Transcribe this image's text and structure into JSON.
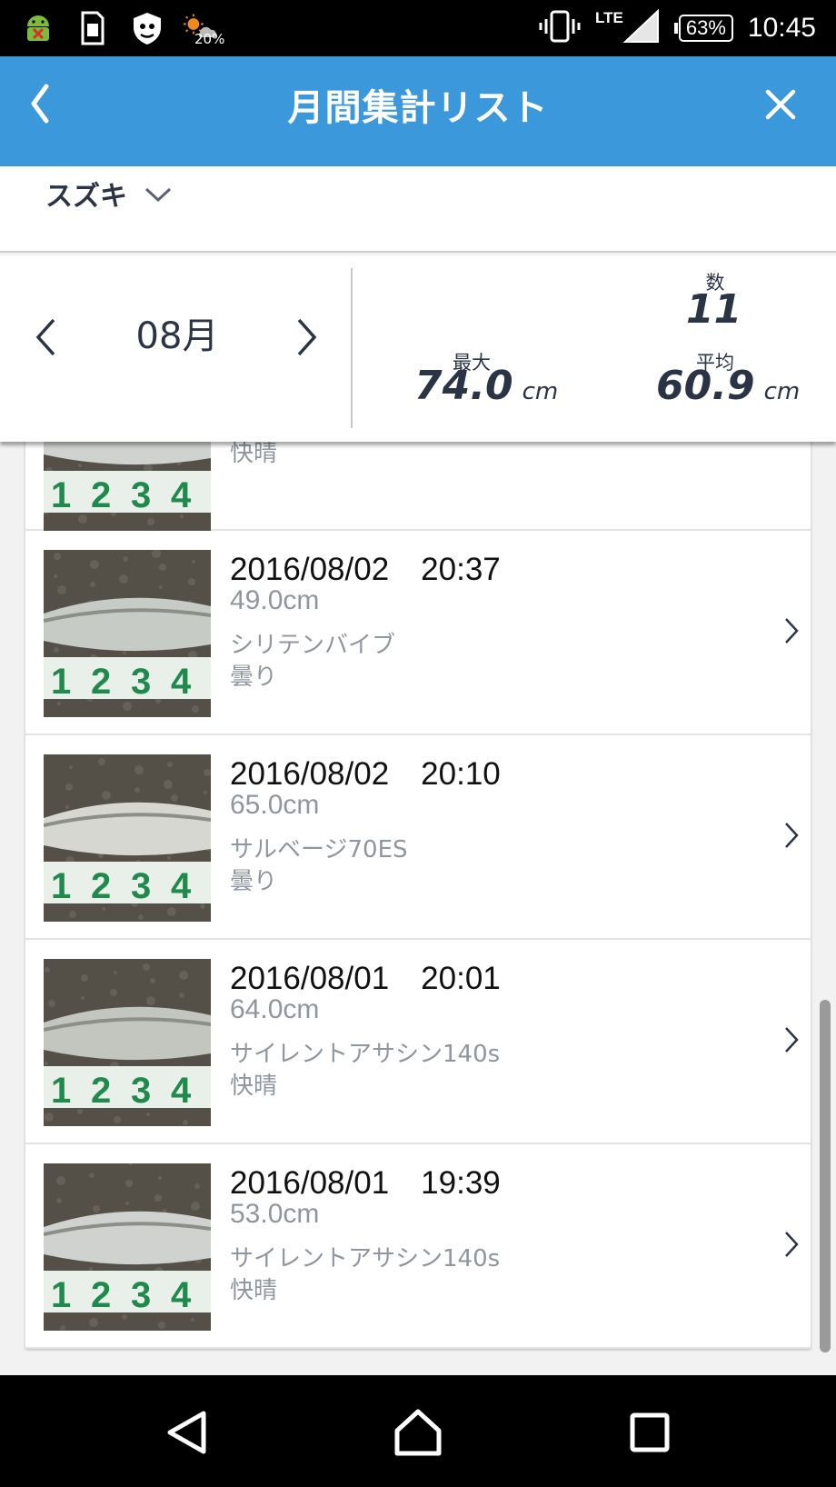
{
  "status_bar": {
    "weather_percent": "20%",
    "network": "LTE",
    "battery": "63%",
    "time": "10:45",
    "icons": [
      "android-debug-icon",
      "sim-card-icon",
      "shield-app-icon",
      "weather-icon",
      "vibrate-icon",
      "signal-icon",
      "battery-icon"
    ]
  },
  "app_bar": {
    "title": "月間集計リスト",
    "back_icon": "chevron-left-icon",
    "close_icon": "close-icon"
  },
  "species_selector": {
    "value": "スズキ",
    "icon": "chevron-down-icon"
  },
  "summary": {
    "month": "08月",
    "count_label": "数",
    "count_value": "11",
    "max_label": "最大",
    "max_value": "74.0",
    "max_unit": "cm",
    "avg_label": "平均",
    "avg_value": "60.9",
    "avg_unit": "cm"
  },
  "catches": [
    {
      "date": "",
      "size": "",
      "lure": "",
      "weather": "快晴",
      "partial": true
    },
    {
      "date": "2016/08/02　20:37",
      "size": "49.0cm",
      "lure": "シリテンバイブ",
      "weather": "曇り"
    },
    {
      "date": "2016/08/02　20:10",
      "size": "65.0cm",
      "lure": "サルベージ70ES",
      "weather": "曇り"
    },
    {
      "date": "2016/08/01　20:01",
      "size": "64.0cm",
      "lure": "サイレントアサシン140s",
      "weather": "快晴"
    },
    {
      "date": "2016/08/01　19:39",
      "size": "53.0cm",
      "lure": "サイレントアサシン140s",
      "weather": "快晴"
    }
  ],
  "colors": {
    "app_bar": "#3a98db",
    "text_dark": "#2b3445",
    "text_muted": "#8f969d"
  }
}
